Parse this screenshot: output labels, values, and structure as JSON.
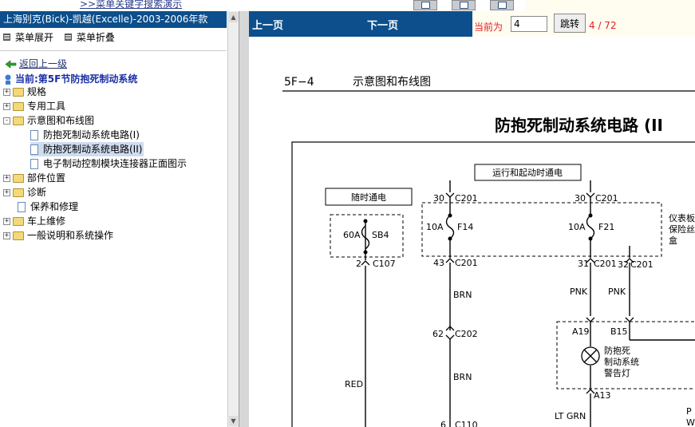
{
  "top": {
    "link": ">>菜单关键字搜索演示"
  },
  "sidebar": {
    "book_title": "上海别克(Bick)-凯越(Excelle)-2003-2006年款",
    "menu_expand": "菜单展开",
    "menu_collapse": "菜单折叠",
    "back": "返回上一级",
    "current": "当前:第5F节防抱死制动系统",
    "tree": [
      {
        "label": "规格"
      },
      {
        "label": "专用工具"
      },
      {
        "label": "示意图和布线图",
        "children": [
          {
            "label": "防抱死制动系统电路(I)"
          },
          {
            "label": "防抱死制动系统电路(II)"
          },
          {
            "label": "电子制动控制模块连接器正面图示"
          }
        ]
      },
      {
        "label": "部件位置"
      },
      {
        "label": "诊断"
      },
      {
        "label": "保养和修理"
      },
      {
        "label": "车上维修"
      },
      {
        "label": "一般说明和系统操作"
      }
    ]
  },
  "nav": {
    "prev": "上一页",
    "next": "下一页",
    "current_label": "当前为",
    "page_value": "4",
    "go": "跳转",
    "page_count": "4 / 72"
  },
  "diagram": {
    "section": "5F−4",
    "section_title": "示意图和布线图",
    "title": "防抱死制动系统电路 (II",
    "labels": {
      "run_start": "运行和起动时通电",
      "hot_at_all_times": "随时通电",
      "fuse_block": [
        "仪表板",
        "保险丝",
        "盒"
      ],
      "sb4_rating": "60A",
      "sb4": "SB4",
      "c107_pin": "2",
      "c107": "C107",
      "f14_in_pin": "30",
      "f14_in_conn": "C201",
      "f14_rating": "10A",
      "f14": "F14",
      "f14_out_pin": "43",
      "f14_out_conn": "C201",
      "f21_in_pin": "30",
      "f21_in_conn": "C201",
      "f21_rating": "10A",
      "f21": "F21",
      "f21_out_pin": "31",
      "f21_out_conn": "C201",
      "c201b_pin": "32",
      "c201b_conn": "C201",
      "wire_brn_1": "BRN",
      "c202_pin": "62",
      "c202": "C202",
      "wire_brn_2": "BRN",
      "wire_red": "RED",
      "c110_pin": "6",
      "c110": "C110",
      "wire_pnk_1": "PNK",
      "wire_pnk_2": "PNK",
      "a19": "A19",
      "b15": "B15",
      "lamp": [
        "防抱死",
        "制动系统",
        "警告灯"
      ],
      "a13": "A13",
      "wire_ltgrn": "LT GRN",
      "edge_p": "P",
      "edge_w": "W"
    }
  }
}
